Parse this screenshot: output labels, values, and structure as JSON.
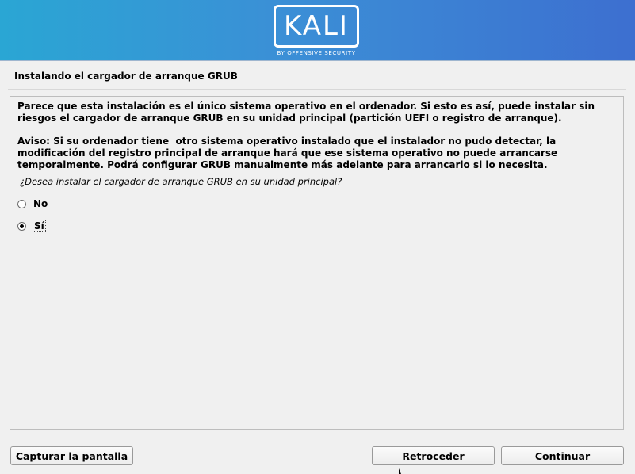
{
  "banner": {
    "logo_text": "KALI",
    "logo_subtext": "BY OFFENSIVE SECURITY",
    "gradient_colors": [
      "#2aa6d4",
      "#3d6fd0"
    ]
  },
  "step_title": "Instalando el cargador de arranque GRUB",
  "content": {
    "paragraph1": "Parece que esta instalación es el único sistema operativo en el ordenador. Si esto es así, puede instalar sin\nriesgos el cargador de arranque GRUB en su unidad principal (partición UEFI o registro de arranque).",
    "paragraph2": "Aviso: Si su ordenador tiene  otro sistema operativo instalado que el instalador no pudo detectar, la\nmodificación del registro principal de arranque hará que ese sistema operativo no puede arrancarse\ntemporalmente. Podrá configurar GRUB manualmente más adelante para arrancarlo si lo necesita.",
    "question": "¿Desea instalar el cargador de arranque GRUB en su unidad principal?",
    "options": [
      {
        "label": "No",
        "selected": false
      },
      {
        "label": "Sí",
        "selected": true
      }
    ]
  },
  "buttons": {
    "screenshot": "Capturar la pantalla",
    "back": "Retroceder",
    "continue": "Continuar"
  }
}
